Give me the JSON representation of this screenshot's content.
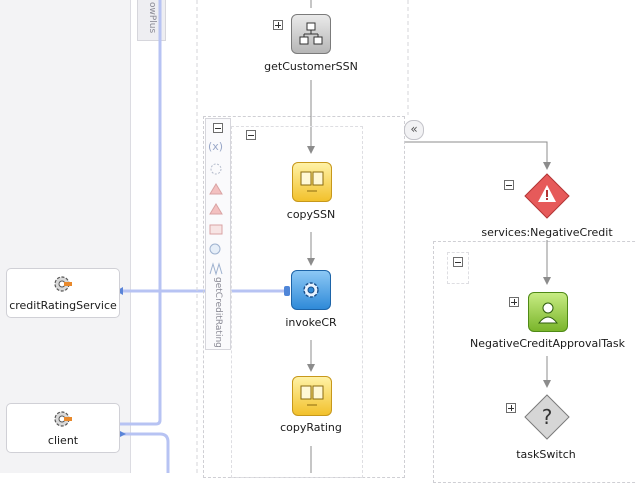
{
  "left_panel": {
    "lane_label": "owPlus",
    "partner_links": [
      {
        "name": "creditRatingService",
        "icon": "gear-icon"
      },
      {
        "name": "client",
        "icon": "gear-icon"
      }
    ]
  },
  "scope": {
    "name": "getCreditRating",
    "tool_icons": [
      "variables-icon",
      "correlation-set-icon",
      "add-event-handler-icon",
      "add-event-handler-icon",
      "add-fault-handler-icon",
      "add-compensation-handler-icon",
      "add-termination-handler-icon"
    ]
  },
  "activities": [
    {
      "label": "getCustomerSSN",
      "type": "scope",
      "icon": "scope-icon"
    },
    {
      "label": "copySSN",
      "type": "assign",
      "icon": "assign-icon"
    },
    {
      "label": "invokeCR",
      "type": "invoke",
      "icon": "invoke-icon"
    },
    {
      "label": "copyRating",
      "type": "assign",
      "icon": "assign-icon"
    }
  ],
  "fault_branch": {
    "label": "services:NegativeCredit",
    "icon": "warning-icon",
    "activities": [
      {
        "label": "NegativeCreditApprovalTask",
        "type": "human-task",
        "icon": "human-task-icon"
      },
      {
        "label": "taskSwitch",
        "type": "switch",
        "icon": "question-icon"
      }
    ]
  },
  "colors": {
    "connector": "#a9b8f0",
    "flow_arrow": "#8c8c8c",
    "fault_red": "#e65a5a"
  }
}
